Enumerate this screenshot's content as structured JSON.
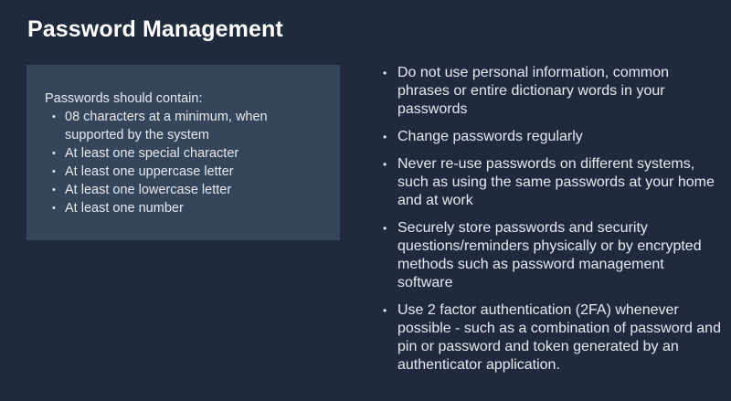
{
  "title": "Password Management",
  "requirements": {
    "heading": "Passwords should contain:",
    "items": [
      "08 characters at a minimum,  when supported by the  system",
      "At least one special  character",
      "At least one uppercase letter",
      "At least one lowercase letter",
      "At least one number"
    ]
  },
  "tips": [
    "Do not use personal information, common phrases or entire  dictionary words in your passwords",
    "Change passwords regularly",
    "Never re-use passwords on different systems, such as using  the same passwords at your home and at work",
    "Securely store passwords and security questions/reminders  physically or by encrypted methods such as password management software",
    "Use 2 factor authentication (2FA) whenever possible - such  as a combination of password and pin or password and token generated by an authenticator application."
  ]
}
